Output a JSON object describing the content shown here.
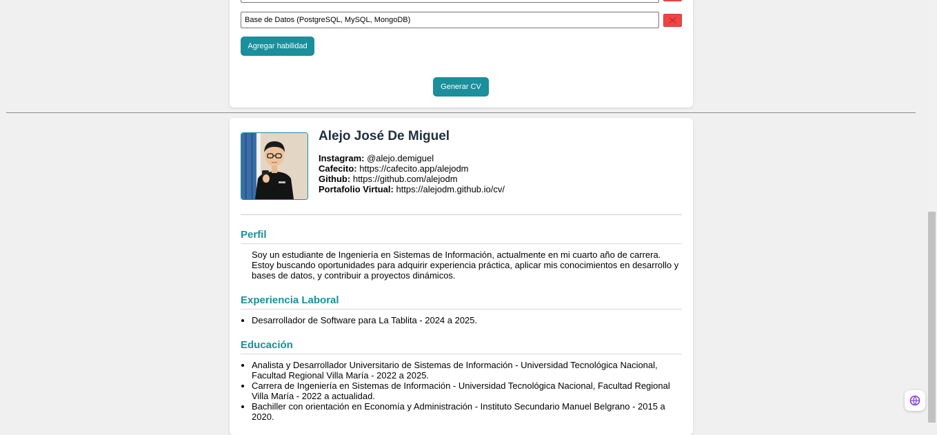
{
  "form": {
    "skills": [
      {
        "value": ""
      },
      {
        "value": "Base de Datos (PostgreSQL, MySQL, MongoDB)"
      }
    ],
    "add_skill_label": "Agregar habilidad",
    "generate_label": "Generar CV"
  },
  "cv": {
    "name": "Alejo José De Miguel",
    "contacts": [
      {
        "label": "Instagram:",
        "value": "@alejo.demiguel"
      },
      {
        "label": "Cafecito:",
        "value": "https://cafecito.app/alejodm"
      },
      {
        "label": "Github:",
        "value": "https://github.com/alejodm"
      },
      {
        "label": "Portafolio Virtual:",
        "value": "https://alejodm.github.io/cv/"
      }
    ],
    "profile_title": "Perfil",
    "profile_text": "Soy un estudiante de Ingeniería en Sistemas de Información, actualmente en mi cuarto año de carrera. Estoy buscando oportunidades para adquirir experiencia práctica, aplicar mis conocimientos en desarrollo y bases de datos, y contribuir a proyectos dinámicos.",
    "experience_title": "Experiencia Laboral",
    "experience": [
      "Desarrollador de Software para La Tablita - 2024 a 2025."
    ],
    "education_title": "Educación",
    "education": [
      "Analista y Desarrollador Universitario de Sistemas de Información - Universidad Tecnológica Nacional, Facultad Regional Villa María - 2022 a 2025.",
      "Carrera de Ingeniería en Sistemas de Información - Universidad Tecnológica Nacional, Facultad Regional Villa María - 2022 a actualidad.",
      "Bachiller con orientación en Economía y Administración - Instituto Secundario Manuel Belgrano - 2015 a 2020."
    ]
  },
  "colors": {
    "accent": "#1b8f9b",
    "delete": "#f04444",
    "name": "#1f2f3f"
  },
  "icons": {
    "delete": "close-icon",
    "extension": "extension-icon"
  }
}
